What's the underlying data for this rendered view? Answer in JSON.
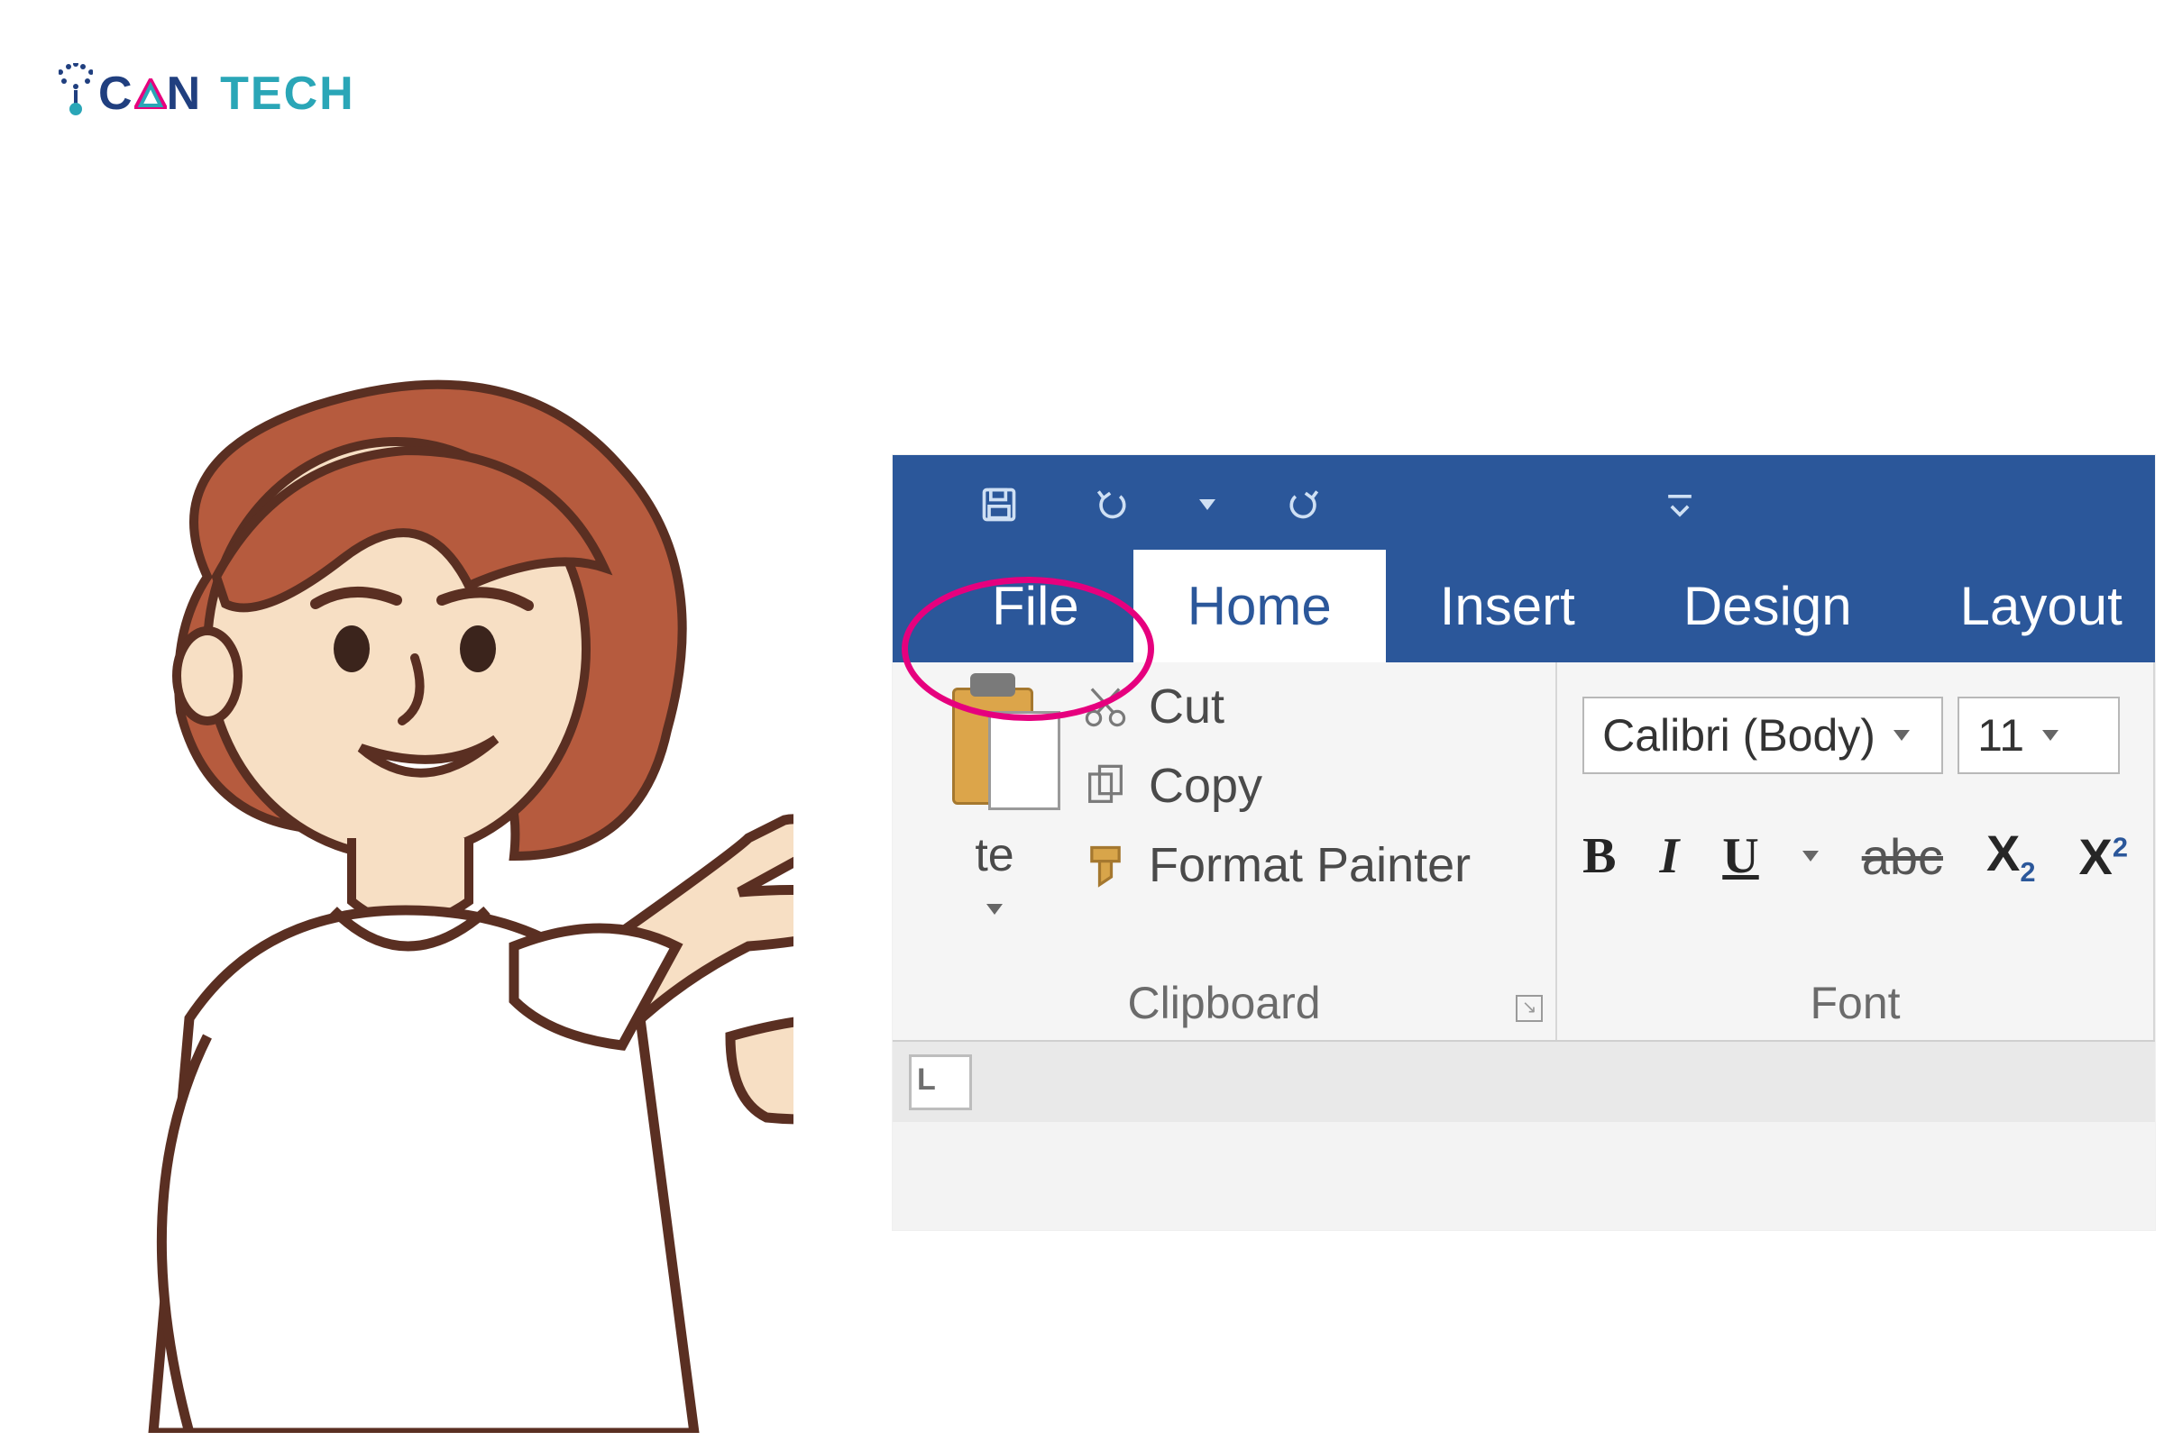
{
  "logo": {
    "can": "CAN",
    "tech": "TECH"
  },
  "qat": {
    "save": "save",
    "undo": "undo",
    "redo": "redo"
  },
  "tabs": {
    "file": "File",
    "home": "Home",
    "insert": "Insert",
    "design": "Design",
    "layout": "Layout"
  },
  "clipboard": {
    "paste": "te",
    "cut": "Cut",
    "copy": "Copy",
    "format_painter": "Format Painter",
    "group_label": "Clipboard"
  },
  "font": {
    "name": "Calibri (Body)",
    "size": "11",
    "group_label": "Font",
    "strike_sample": "abc",
    "sub_sample_base": "X",
    "sub_sample_idx": "2",
    "sup_sample_base": "X",
    "sup_sample_idx": "2"
  },
  "ruler_corner": "L"
}
